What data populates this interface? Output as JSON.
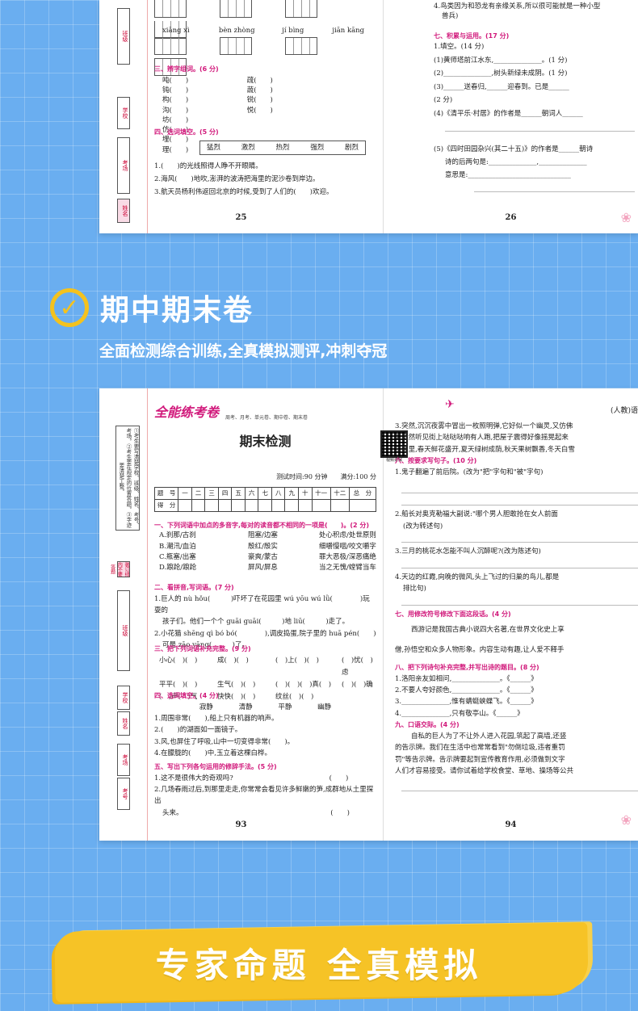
{
  "top_sheet": {
    "left_page": {
      "pinyin": [
        "xiāng xì",
        "bèn zhòng",
        "jí bìng",
        "jiān kāng"
      ],
      "sec3_title": "三、辨字组词。(6 分)",
      "sec3_cols": [
        [
          "吨(　　)",
          "钝(　　)",
          "构(　　)",
          "沟(　　)"
        ],
        [
          "疏(　　)",
          "蔬(　　)",
          "锐(　　)",
          "悦(　　)"
        ],
        [
          "坊(　　)",
          "仿(　　)",
          "埋(　　)",
          "理(　　)"
        ]
      ],
      "sec4_title": "四、选词填空。(5 分)",
      "sec4_words": [
        "猛烈",
        "激烈",
        "热烈",
        "强烈",
        "剧烈"
      ],
      "sec4_items": [
        "1.(　　)的光线照得人睁不开眼睛。",
        "2.海风(　　)地吹,澎湃的波涛把海里的泥沙卷到岸边。",
        "3.航天员杨利伟返回北京的时候,受到了人们的(　　)欢迎。"
      ],
      "side_labels": [
        "班级",
        "学校",
        "考场",
        "姓名"
      ],
      "page_no": "25"
    },
    "right_page": {
      "line4": "4.鸟类因为和恐龙有亲缘关系,所以很可能就是一种小型",
      "line4b": "兽兵)",
      "sec7_title": "七、积累与运用。(17 分)",
      "items": [
        "1.填空。(14 分)",
        "(1)黄师塔前江水东,______________。(1 分)",
        "(2)______________,树头新绿未成阴。(1 分)",
        "(3)______送春归,______迎春到。已是______",
        "(2 分)",
        "(4)《清平乐·村居》的作者是______朝词人______"
      ],
      "item5a": "(5)《四时田园杂兴(其二十五)》的作者是______朝诗",
      "item5b": "诗的后两句是:______________,______________",
      "item5c": "意思是:______________________________",
      "page_no": "26"
    }
  },
  "heading": {
    "check": "✓",
    "title": "期中期末卷",
    "subtitle": "全面检测综合训练,全真模拟测评,冲刺夺冠"
  },
  "bottom_sheet": {
    "left_page": {
      "brand": "全能练考卷",
      "brand_tags": "周考、月考、单元卷、期中卷、期末卷",
      "exam_title": "期末检测",
      "qr_label": "视频讲解",
      "exam_meta": "测试时间:90 分钟　　满分:100 分",
      "score_header": [
        "题　号",
        "一",
        "二",
        "三",
        "四",
        "五",
        "六",
        "七",
        "八",
        "九",
        "十",
        "十一",
        "十二",
        "总　分"
      ],
      "score_row": "得　分",
      "notice": "①考生要写清楚学校、班级、姓名、考号、考场。②考生要在规定的位置答题。③字迹要清楚工整。",
      "sec1_title": "一、下列词语中加点的多音字,每对的读音都不相同的一项是(　　)。(2 分)",
      "sec1_rows": [
        [
          "A.刹那/古刹",
          "阻塞/边塞",
          "处心积虑/处世原则"
        ],
        [
          "B.潮汛/血泊",
          "殷红/殷实",
          "细嚼慢咽/咬文嚼字"
        ],
        [
          "C.瓶塞/出塞",
          "豪爽/蒙古",
          "罪大恶极/深恶痛绝"
        ],
        [
          "D.踉跄/踉跄",
          "屏风/屏息",
          "当之无愧/螳臂当车"
        ]
      ],
      "sec2_title": "二、看拼音,写词语。(7 分)",
      "sec2_lines": [
        "1.巨人的 nù hǒu(　　　)吓坏了在花园里 wú yōu wú lǜ(　　　　)玩耍的",
        "孩子们。他们一个个 guāi guāi(　　　)地 liū(　　　)走了。",
        "2.小花猫 shēng qì bó bó(　　　　),调皮捣蛋,院子里的 huā pén(　　)",
        "可是 zāo yāng(　　　)了。"
      ],
      "sec3_title": "三、把下列词语补充完整。(9 分)",
      "sec3_rows": [
        [
          "小心(　)(　)",
          "成(　)(　)",
          "(　)上(　)(　)",
          "(　)忧(　)虑"
        ],
        [
          "平平(　)(　)",
          "生气(　)(　)",
          "(　)(　)(　)真(　)",
          "(　)(　)确"
        ],
        [
          "(　)声(　)气",
          "快快(　)(　)",
          "纹丝(　)(　)",
          ""
        ]
      ],
      "sec4_title": "四、选词填空。(4 分)",
      "sec4_words": [
        "寂静",
        "清静",
        "平静",
        "幽静"
      ],
      "sec4_items": [
        "1.周围非常(　　),船上只有机器的响声。",
        "2.(　　)的湖面如一面镜子。",
        "3.风,也屏住了呼吸,山中一切变得非常(　　)。",
        "4.在朦胧的(　　)中,玉立着这棵白桦。"
      ],
      "sec5_title": "五、写出下列各句运用的修辞手法。(5 分)",
      "sec5_items": [
        "1.这不是很伟大的奇观吗?　　　　　　　　　　　　　　(　　)",
        "2.几场春雨过后,到那里走走,你常常会看见许多鲜嫩的笋,成群地从土里探出",
        "头来。　　　　　　　　　　　　　　　　　　　　　　(　　)"
      ],
      "side_labels": [
        "班级",
        "学校",
        "姓名",
        "考场",
        "考号"
      ],
      "cut_line": "装订线内不要答题",
      "page_no": "93"
    },
    "right_page": {
      "corner": "(人教)语",
      "top_lines": [
        "3.突然,沉沉夜雾中冒出一枚照明弹,它好似一个幽灵,又仿佛",
        "4.忽然听见街上哒哒哒响有人跑,把屋子震得好像摇晃起来",
        "5.那里,春天鲜花盛开,夏天绿树成荫,秋天果树飘香,冬天白雪"
      ],
      "sec6_title": "六、按要求写句子。(10 分)",
      "sec6_items": [
        "1.鬼子翻遍了前后院。(改为\"把\"字句和\"被\"字句)",
        "2.船长对奥克勒福大副说:\"哪个男人胆敢抢在女人前面",
        "(改为转述句)",
        "3.三月的桃花水怎能不叫人沉醉呢?(改为陈述句)",
        "4.天边的红霞,向晚的微风,头上飞过的归巢的鸟儿,都是",
        "排比句)"
      ],
      "sec7_title": "七、用修改符号修改下面这段话。(4 分)",
      "sec7_text1": "西游记是我国古典小说四大名著,在世界文化史上享",
      "sec7_text2": "僧,孙悟空和众多人物形象。内容生动有趣,让人爱不释手",
      "sec8_title": "八、把下列诗句补充完整,并写出诗的题目。(8 分)",
      "sec8_items": [
        "1.洛阳亲友如相问,______________。《______》",
        "2.不要人夸好颜色,______________。《______》",
        "3.______________,惟有蜻蜓蛱蝶飞。《______》",
        "4.______________,只有敬亭山。《______》"
      ],
      "sec9_title": "九、口语交际。(4 分)",
      "sec9_text": [
        "自私的巨人为了不让外人进入花园,筑起了高墙,还竖",
        "的告示牌。我们在生活中也常常看到\"勿倒垃圾,违者重罚",
        "罚\"等告示牌。告示牌要起到宣传教育作用,必须做到文字",
        "人们才容易接受。请你试着给学校食堂、草地、操场等公共"
      ],
      "page_no": "94"
    }
  },
  "footer": {
    "slogan": "专家命题 全真模拟"
  },
  "colors": {
    "background": "#6aaef0",
    "accent_yellow": "#f4c21e",
    "magenta": "#d1197b"
  }
}
